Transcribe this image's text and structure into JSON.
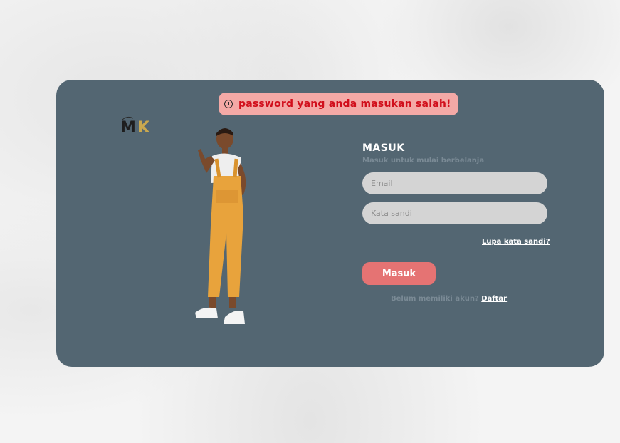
{
  "alert": {
    "icon": "clock-icon",
    "message": "password yang anda masukan salah!",
    "background": "#f4a9a6",
    "text_color": "#d10f1c"
  },
  "logo": {
    "text": "MK"
  },
  "form": {
    "title": "MASUK",
    "subtitle": "Masuk untuk mulai berbelanja",
    "email": {
      "value": "",
      "placeholder": "Email"
    },
    "password": {
      "value": "",
      "placeholder": "Kata sandi"
    },
    "forgot_link": "Lupa kata sandi?",
    "submit_label": "Masuk",
    "register_prompt": "Belum memiliki akun?",
    "register_link": "Daftar"
  },
  "colors": {
    "card": "#536672",
    "button": "#e57373",
    "input": "#d4d4d4"
  }
}
